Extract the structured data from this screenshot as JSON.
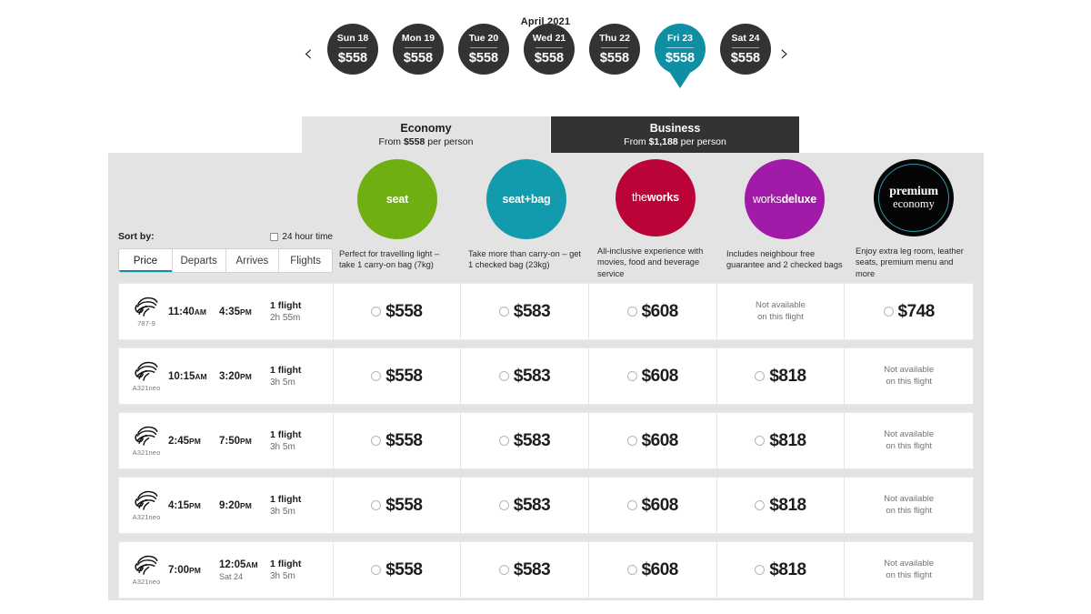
{
  "date_strip": {
    "month": "April 2021",
    "prev_icon": "chevron-left-icon",
    "next_icon": "chevron-right-icon",
    "days": [
      {
        "name": "Sun 18",
        "price": "$558",
        "selected": false
      },
      {
        "name": "Mon 19",
        "price": "$558",
        "selected": false
      },
      {
        "name": "Tue 20",
        "price": "$558",
        "selected": false
      },
      {
        "name": "Wed 21",
        "price": "$558",
        "selected": false
      },
      {
        "name": "Thu 22",
        "price": "$558",
        "selected": false
      },
      {
        "name": "Fri 23",
        "price": "$558",
        "selected": true
      },
      {
        "name": "Sat 24",
        "price": "$558",
        "selected": false
      }
    ]
  },
  "cabin_tabs": [
    {
      "title": "Economy",
      "from": "From",
      "price": "$558",
      "per": "per person",
      "state": "light"
    },
    {
      "title": "Business",
      "from": "From",
      "price": "$1,188",
      "per": "per person",
      "state": "dark"
    }
  ],
  "fares": [
    {
      "id": "seat",
      "label": "seat",
      "color": "#6FAF12",
      "description": "Perfect for travelling light – take 1 carry-on bag (7kg)"
    },
    {
      "id": "seat-bag",
      "label": "seat+bag",
      "color": "#119BAC",
      "description": "Take more than carry-on – get 1 checked bag (23kg)"
    },
    {
      "id": "theworks",
      "label": "theworks",
      "label_light": "the",
      "label_bold": "works",
      "color": "#BC0338",
      "description": "All-inclusive experience with movies, food and beverage service"
    },
    {
      "id": "worksdeluxe",
      "label": "worksdeluxe",
      "label_light": "works",
      "label_bold": "deluxe",
      "color": "#A21AA8",
      "description": "Includes neighbour free guarantee and 2 checked bags"
    },
    {
      "id": "premium-economy",
      "label": "premium economy",
      "label_line1": "premium",
      "label_line2": "economy",
      "color": "#050505",
      "ring_color": "#2E97AA",
      "description": "Enjoy extra leg room, leather seats, premium menu and more"
    }
  ],
  "sort": {
    "label": "Sort by:",
    "hour_toggle_label": "24 hour time",
    "hour_toggle_checked": false,
    "options": [
      {
        "label": "Price",
        "active": true
      },
      {
        "label": "Departs",
        "active": false
      },
      {
        "label": "Arrives",
        "active": false
      },
      {
        "label": "Flights",
        "active": false
      }
    ]
  },
  "not_available_text_line1": "Not available",
  "not_available_text_line2": "on this flight",
  "flights": [
    {
      "aircraft": "787-9",
      "depart_time": "11:40",
      "depart_meridiem": "AM",
      "depart_sub": "",
      "arrive_time": "4:35",
      "arrive_meridiem": "PM",
      "arrive_sub": "",
      "stops": "1 flight",
      "duration": "2h 55m",
      "prices": [
        {
          "price": "$558",
          "available": true
        },
        {
          "price": "$583",
          "available": true
        },
        {
          "price": "$608",
          "available": true
        },
        {
          "price": "",
          "available": false
        },
        {
          "price": "$748",
          "available": true
        }
      ]
    },
    {
      "aircraft": "A321neo",
      "depart_time": "10:15",
      "depart_meridiem": "AM",
      "depart_sub": "",
      "arrive_time": "3:20",
      "arrive_meridiem": "PM",
      "arrive_sub": "",
      "stops": "1 flight",
      "duration": "3h 5m",
      "prices": [
        {
          "price": "$558",
          "available": true
        },
        {
          "price": "$583",
          "available": true
        },
        {
          "price": "$608",
          "available": true
        },
        {
          "price": "$818",
          "available": true
        },
        {
          "price": "",
          "available": false
        }
      ]
    },
    {
      "aircraft": "A321neo",
      "depart_time": "2:45",
      "depart_meridiem": "PM",
      "depart_sub": "",
      "arrive_time": "7:50",
      "arrive_meridiem": "PM",
      "arrive_sub": "",
      "stops": "1 flight",
      "duration": "3h 5m",
      "prices": [
        {
          "price": "$558",
          "available": true
        },
        {
          "price": "$583",
          "available": true
        },
        {
          "price": "$608",
          "available": true
        },
        {
          "price": "$818",
          "available": true
        },
        {
          "price": "",
          "available": false
        }
      ]
    },
    {
      "aircraft": "A321neo",
      "depart_time": "4:15",
      "depart_meridiem": "PM",
      "depart_sub": "",
      "arrive_time": "9:20",
      "arrive_meridiem": "PM",
      "arrive_sub": "",
      "stops": "1 flight",
      "duration": "3h 5m",
      "prices": [
        {
          "price": "$558",
          "available": true
        },
        {
          "price": "$583",
          "available": true
        },
        {
          "price": "$608",
          "available": true
        },
        {
          "price": "$818",
          "available": true
        },
        {
          "price": "",
          "available": false
        }
      ]
    },
    {
      "aircraft": "A321neo",
      "depart_time": "7:00",
      "depart_meridiem": "PM",
      "depart_sub": "",
      "arrive_time": "12:05",
      "arrive_meridiem": "AM",
      "arrive_sub": "Sat 24",
      "stops": "1 flight",
      "duration": "3h 5m",
      "prices": [
        {
          "price": "$558",
          "available": true
        },
        {
          "price": "$583",
          "available": true
        },
        {
          "price": "$608",
          "available": true
        },
        {
          "price": "$818",
          "available": true
        },
        {
          "price": "",
          "available": false
        }
      ]
    }
  ]
}
